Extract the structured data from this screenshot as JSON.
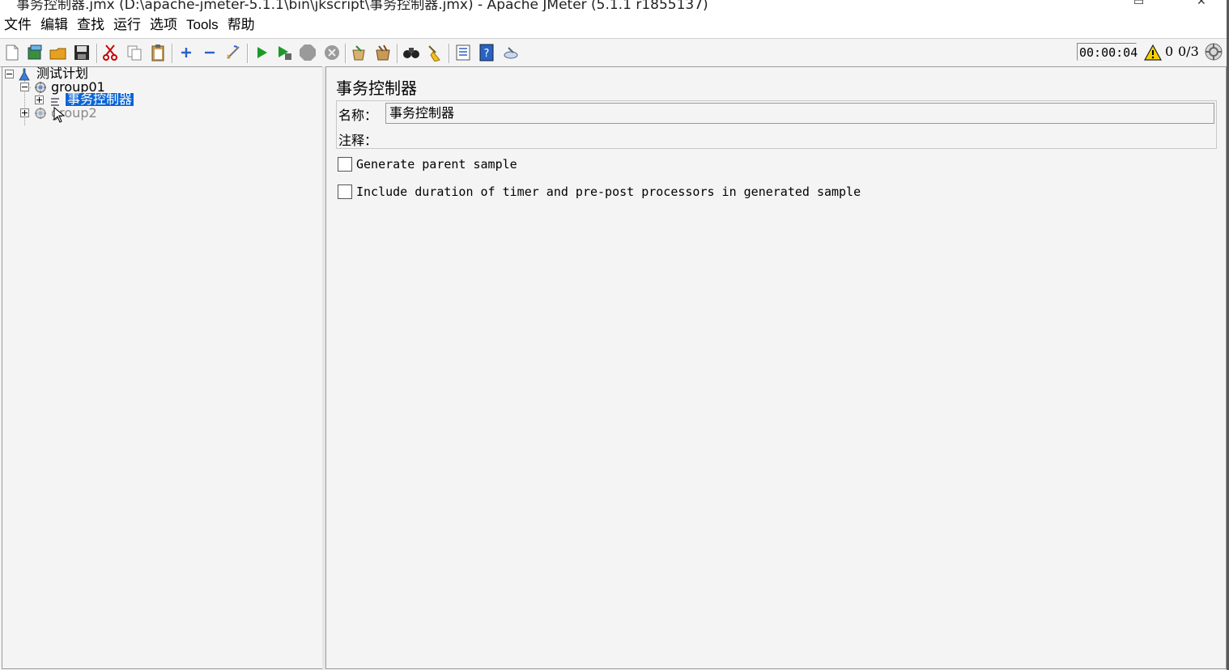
{
  "window": {
    "title": "事务控制器.jmx (D:\\apache-jmeter-5.1.1\\bin\\jkscript\\事务控制器.jmx) - Apache JMeter (5.1.1 r1855137)"
  },
  "menubar": {
    "items": [
      "文件",
      "编辑",
      "查找",
      "运行",
      "选项",
      "Tools",
      "帮助"
    ]
  },
  "toolbar": {
    "buttons": [
      "new-icon",
      "templates-icon",
      "open-icon",
      "save-icon",
      "cut-icon",
      "copy-icon",
      "paste-icon",
      "expand-icon",
      "collapse-icon",
      "toggle-icon",
      "start-icon",
      "start-no-pause-icon",
      "stop-icon",
      "shutdown-icon",
      "clear-icon",
      "clear-all-icon",
      "search-icon",
      "reset-search-icon",
      "function-helper-icon",
      "help-icon",
      "remote-icon"
    ],
    "timer": "00:00:04",
    "error_count": "0",
    "thread_count": "0/3"
  },
  "tree": {
    "root": "测试计划",
    "group1": "group01",
    "controller": "事务控制器",
    "group2": "group2"
  },
  "panel": {
    "title": "事务控制器",
    "name_label": "名称：",
    "name_value": "事务控制器",
    "comment_label": "注释：",
    "checkbox1": "Generate parent sample",
    "checkbox2": "Include duration of timer and pre-post processors in generated sample"
  }
}
